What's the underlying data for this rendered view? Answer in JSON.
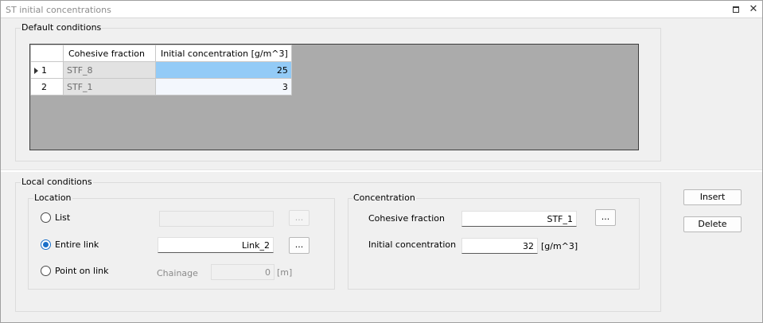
{
  "window": {
    "title": "ST initial concentrations",
    "restore_icon": "restore-icon",
    "close_icon": "close-icon",
    "close_glyph": "✕"
  },
  "default_conditions": {
    "label": "Default conditions",
    "columns": [
      "Cohesive fraction",
      "Initial concentration [g/m^3]"
    ],
    "rows": [
      {
        "num": "1",
        "fraction": "STF_8",
        "concentration": "25",
        "selected": true
      },
      {
        "num": "2",
        "fraction": "STF_1",
        "concentration": "3",
        "selected": false
      }
    ]
  },
  "local_conditions": {
    "label": "Local conditions",
    "location": {
      "label": "Location",
      "list_label": "List",
      "list_value": "",
      "list_browse": "...",
      "entire_link_label": "Entire link",
      "entire_link_value": "Link_2",
      "entire_link_browse": "...",
      "point_on_link_label": "Point on link",
      "chainage_label": "Chainage",
      "chainage_value": "0",
      "chainage_unit": "[m]",
      "selected_option": "Entire link"
    },
    "concentration": {
      "label": "Concentration",
      "fraction_label": "Cohesive fraction",
      "fraction_value": "STF_1",
      "fraction_browse": "...",
      "initial_label": "Initial concentration",
      "initial_value": "32",
      "initial_unit": "[g/m^3]"
    }
  },
  "buttons": {
    "insert": "Insert",
    "delete": "Delete"
  }
}
